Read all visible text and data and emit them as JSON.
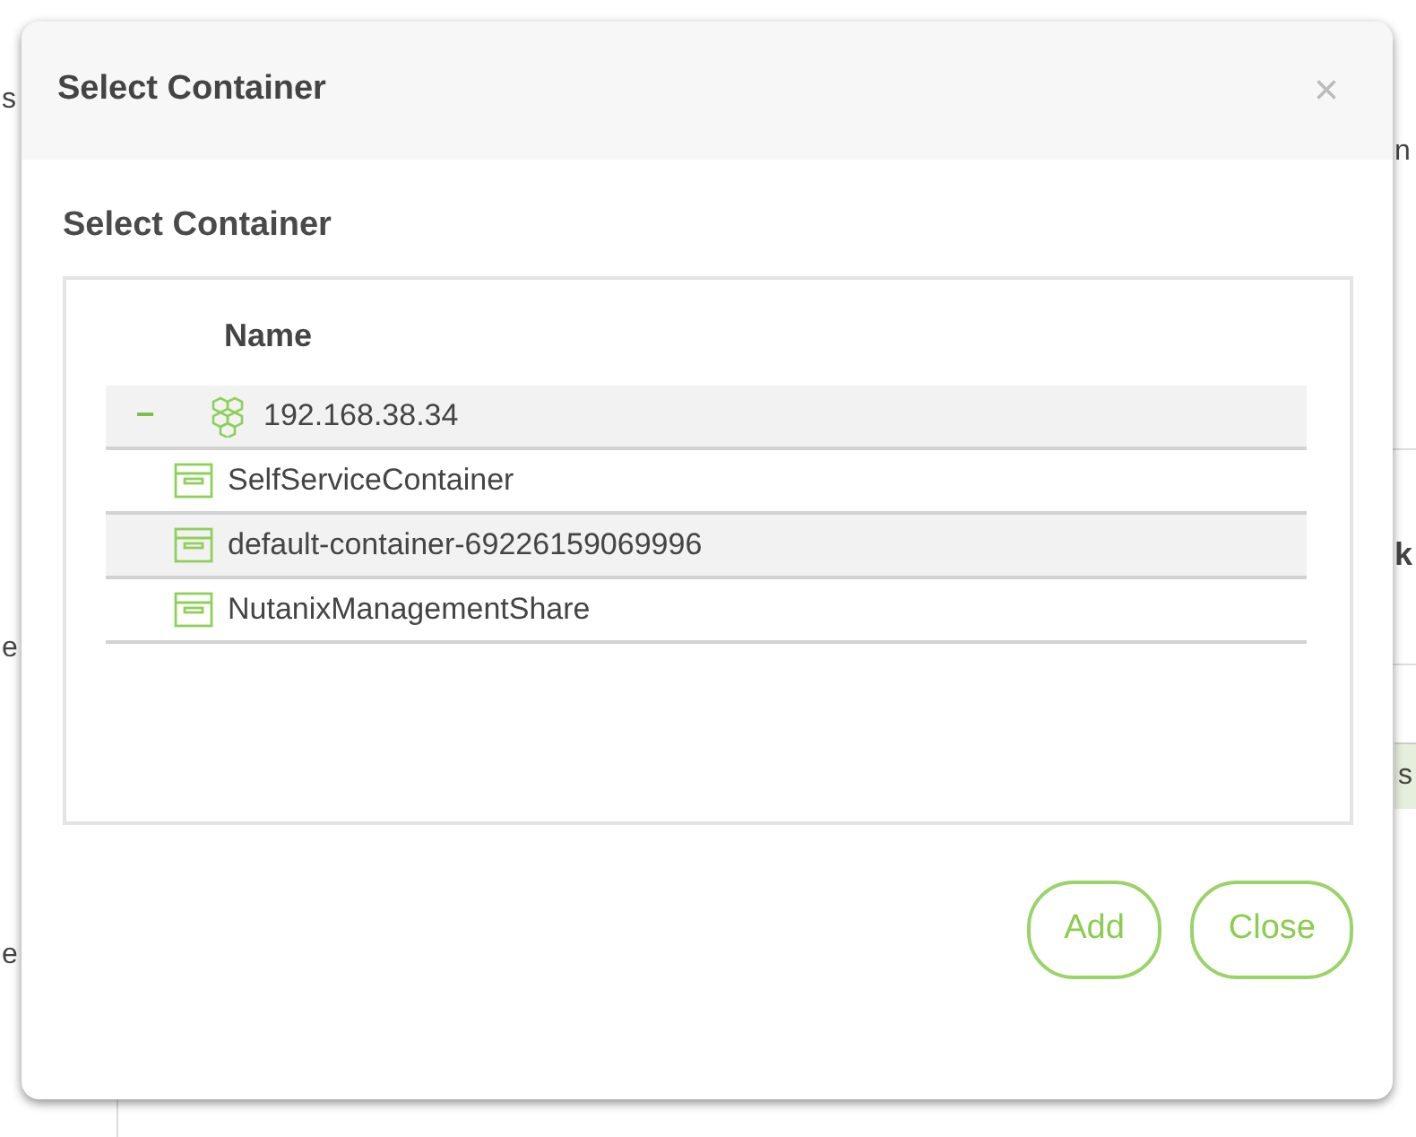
{
  "background": {
    "fragments": [
      {
        "text": "s",
        "kind": "plain"
      },
      {
        "text": "n",
        "kind": "plain"
      },
      {
        "text": "k",
        "kind": "heading"
      },
      {
        "text": "e",
        "kind": "plain"
      },
      {
        "text": "s",
        "kind": "cell"
      },
      {
        "text": "e",
        "kind": "plain"
      }
    ]
  },
  "dialog": {
    "title": "Select Container",
    "close": "×",
    "section_title": "Select Container",
    "tree": {
      "column": "Name",
      "nodes": [
        {
          "label": "192.168.38.34",
          "kind": "host",
          "expanded": true,
          "toggle": "−",
          "children": [
            {
              "label": "SelfServiceContainer",
              "kind": "container"
            },
            {
              "label": "default-container-69226159069996",
              "kind": "container"
            },
            {
              "label": "NutanixManagementShare",
              "kind": "container"
            }
          ]
        }
      ]
    }
  },
  "buttons": [
    "Add",
    "Close"
  ]
}
